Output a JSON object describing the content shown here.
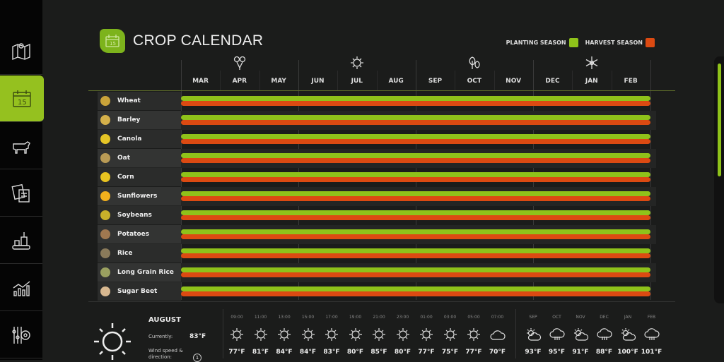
{
  "sidebar": {
    "items": [
      {
        "name": "map",
        "icon": "map-pin-icon"
      },
      {
        "name": "calendar",
        "icon": "calendar-icon",
        "active": true
      },
      {
        "name": "animals",
        "icon": "cow-icon"
      },
      {
        "name": "contracts",
        "icon": "documents-icon"
      },
      {
        "name": "production",
        "icon": "factory-icon"
      },
      {
        "name": "statistics",
        "icon": "chart-icon"
      },
      {
        "name": "settings",
        "icon": "settings-icon"
      }
    ]
  },
  "header": {
    "title": "CROP CALENDAR",
    "icon": "calendar-icon"
  },
  "legend": {
    "planting": "PLANTING SEASON",
    "harvest": "HARVEST SEASON",
    "planting_color": "#8fc21a",
    "harvest_color": "#dc4a12"
  },
  "months": [
    "MAR",
    "APR",
    "MAY",
    "JUN",
    "JUL",
    "AUG",
    "SEP",
    "OCT",
    "NOV",
    "DEC",
    "JAN",
    "FEB"
  ],
  "season_icons": [
    "flower-icon",
    "sun-icon",
    "leaves-icon",
    "snowflake-icon"
  ],
  "crops": [
    {
      "name": "Wheat",
      "planting": "MAR-FEB",
      "harvest": "MAR-FEB"
    },
    {
      "name": "Barley",
      "planting": "MAR-FEB",
      "harvest": "MAR-FEB"
    },
    {
      "name": "Canola",
      "planting": "MAR-FEB",
      "harvest": "MAR-FEB"
    },
    {
      "name": "Oat",
      "planting": "MAR-FEB",
      "harvest": "MAR-FEB"
    },
    {
      "name": "Corn",
      "planting": "MAR-FEB",
      "harvest": "MAR-FEB"
    },
    {
      "name": "Sunflowers",
      "planting": "MAR-FEB",
      "harvest": "MAR-FEB"
    },
    {
      "name": "Soybeans",
      "planting": "MAR-FEB",
      "harvest": "MAR-FEB"
    },
    {
      "name": "Potatoes",
      "planting": "MAR-FEB",
      "harvest": "MAR-FEB"
    },
    {
      "name": "Rice",
      "planting": "MAR-FEB",
      "harvest": "MAR-FEB"
    },
    {
      "name": "Long Grain Rice",
      "planting": "MAR-FEB",
      "harvest": "MAR-FEB"
    },
    {
      "name": "Sugar Beet",
      "planting": "MAR-FEB",
      "harvest": "MAR-FEB"
    }
  ],
  "weather": {
    "month": "AUGUST",
    "currently_label": "Currently:",
    "currently": "83°F",
    "wind_label": "Wind speed & direction:",
    "wind": "1",
    "hourly": [
      {
        "time": "09:00",
        "icon": "sun",
        "temp": "77°F"
      },
      {
        "time": "11:00",
        "icon": "sun",
        "temp": "81°F"
      },
      {
        "time": "13:00",
        "icon": "sun",
        "temp": "84°F"
      },
      {
        "time": "15:00",
        "icon": "sun",
        "temp": "84°F"
      },
      {
        "time": "17:00",
        "icon": "sun",
        "temp": "83°F"
      },
      {
        "time": "19:00",
        "icon": "sun",
        "temp": "80°F"
      },
      {
        "time": "21:00",
        "icon": "sun",
        "temp": "85°F"
      },
      {
        "time": "23:00",
        "icon": "sun",
        "temp": "80°F"
      },
      {
        "time": "01:00",
        "icon": "sun",
        "temp": "77°F"
      },
      {
        "time": "03:00",
        "icon": "sun",
        "temp": "75°F"
      },
      {
        "time": "05:00",
        "icon": "sun",
        "temp": "77°F"
      },
      {
        "time": "07:00",
        "icon": "cloud",
        "temp": "70°F"
      }
    ],
    "monthly": [
      {
        "month": "SEP",
        "icon": "partly-cloudy",
        "temp": "93°F"
      },
      {
        "month": "OCT",
        "icon": "rain",
        "temp": "95°F"
      },
      {
        "month": "NOV",
        "icon": "partly-cloudy",
        "temp": "91°F"
      },
      {
        "month": "DEC",
        "icon": "rain",
        "temp": "88°F"
      },
      {
        "month": "JAN",
        "icon": "partly-cloudy",
        "temp": "100°F"
      },
      {
        "month": "FEB",
        "icon": "rain",
        "temp": "101°F"
      }
    ]
  }
}
